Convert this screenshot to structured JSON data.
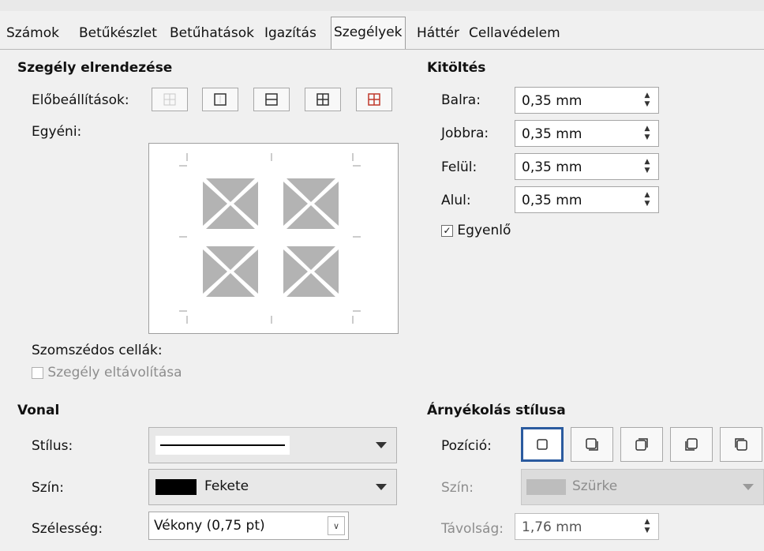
{
  "tabs": [
    "Számok",
    "Betűkészlet",
    "Betűhatások",
    "Igazítás",
    "Szegélyek",
    "Háttér",
    "Cellavédelem"
  ],
  "active_tab": "Szegélyek",
  "border_layout": {
    "title": "Szegély elrendezése",
    "presets_label": "Előbeállítások:",
    "custom_label": "Egyéni:",
    "presets": [
      "no-border-icon",
      "outer-border-icon",
      "outer-horizontal-icon",
      "outer-all-inner-icon",
      "outer-keep-inner-icon"
    ]
  },
  "adjacent": {
    "label": "Szomszédos cellák:",
    "remove_border_label": "Szegély eltávolítása",
    "remove_border_checked": false
  },
  "padding": {
    "title": "Kitöltés",
    "rows": [
      {
        "label": "Balra:",
        "value": "0,35 mm"
      },
      {
        "label": "Jobbra:",
        "value": "0,35 mm"
      },
      {
        "label": "Felül:",
        "value": "0,35 mm"
      },
      {
        "label": "Alul:",
        "value": "0,35 mm"
      }
    ],
    "sync_label": "Egyenlő",
    "sync_checked": true
  },
  "line": {
    "title": "Vonal",
    "style_label": "Stílus:",
    "color_label": "Szín:",
    "color_value": "Fekete",
    "color_swatch": "#000000",
    "width_label": "Szélesség:",
    "width_value": "Vékony (0,75 pt)"
  },
  "shadow": {
    "title": "Árnyékolás stílusa",
    "position_label": "Pozíció:",
    "positions": [
      "no-shadow-icon",
      "shadow-bottom-right-icon",
      "shadow-top-right-icon",
      "shadow-bottom-left-icon",
      "shadow-top-left-icon"
    ],
    "color_label": "Szín:",
    "color_value": "Szürke",
    "distance_label": "Távolság:",
    "distance_value": "1,76 mm"
  }
}
